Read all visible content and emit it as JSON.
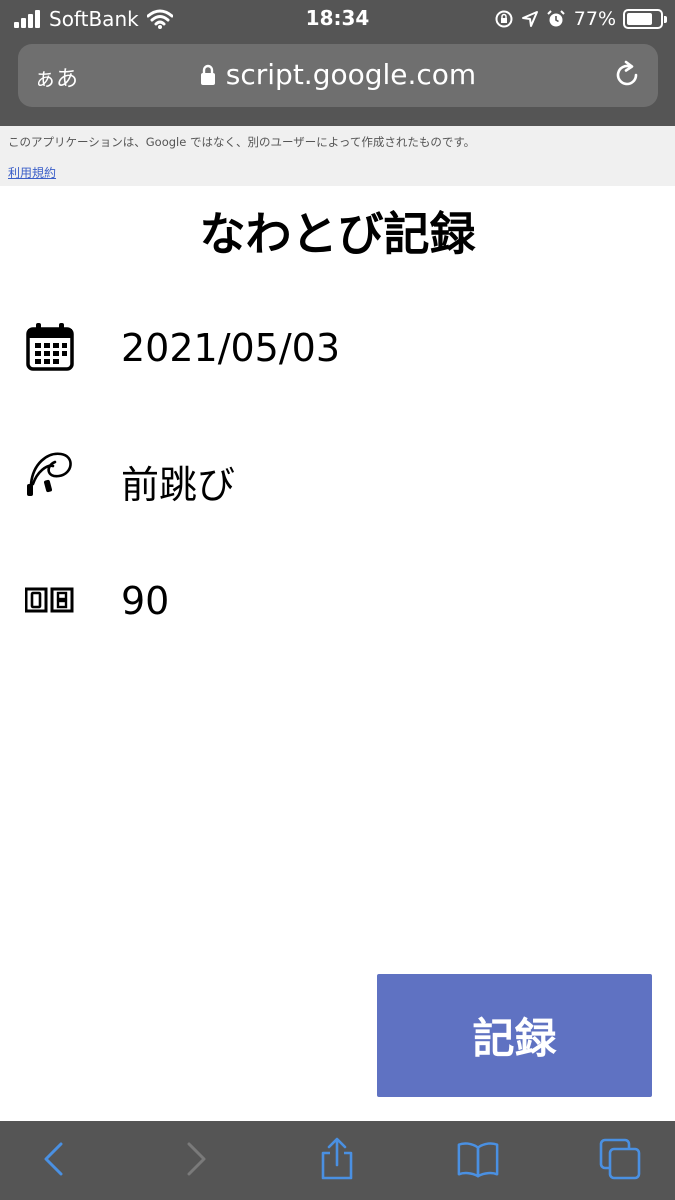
{
  "status_bar": {
    "carrier": "SoftBank",
    "time": "18:34",
    "battery_percent": "77%",
    "battery_level": 0.77
  },
  "browser": {
    "text_size_label": "ぁあ",
    "url": "script.google.com"
  },
  "banner": {
    "notice": "このアプリケーションは、Google ではなく、別のユーザーによって作成されたものです。",
    "terms_link": "利用規約"
  },
  "page": {
    "title": "なわとび記録",
    "date_value": "2021/05/03",
    "jump_type_value": "前跳び",
    "count_value": "90",
    "record_button_label": "記録"
  },
  "colors": {
    "button": "#5f72c2",
    "toolbar_icon": "#4a90e2",
    "browser_chrome": "#555555"
  },
  "icons": {
    "date": "calendar-icon",
    "jump_type": "jump-rope-icon",
    "count": "counter-icon"
  }
}
